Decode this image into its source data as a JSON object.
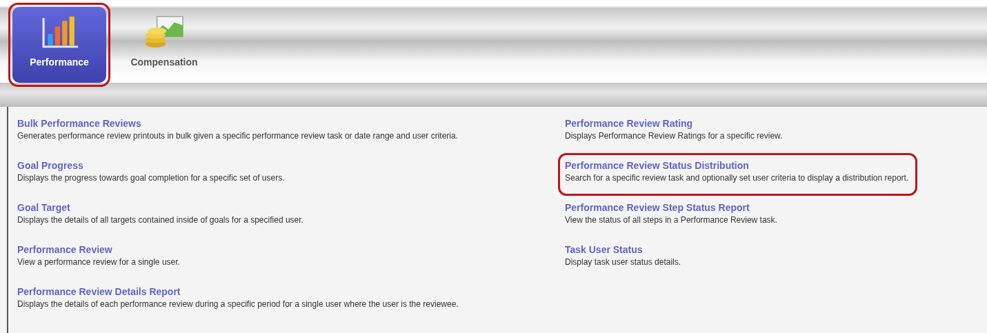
{
  "tabs": [
    {
      "label": "Performance",
      "kind": "bar-chart",
      "selected": true,
      "highlighted": true
    },
    {
      "label": "Compensation",
      "kind": "coins-chart",
      "selected": false,
      "highlighted": false
    }
  ],
  "reports": {
    "columns": [
      [
        {
          "title": "Bulk Performance Reviews",
          "description": "Generates performance review printouts in bulk given a specific performance review task or date range and user criteria.",
          "highlighted": false
        },
        {
          "title": "Goal Progress",
          "description": "Displays the progress towards goal completion for a specific set of users.",
          "highlighted": false
        },
        {
          "title": "Goal Target",
          "description": "Displays the details of all targets contained inside of goals for a specified user.",
          "highlighted": false
        },
        {
          "title": "Performance Review",
          "description": "View a performance review for a single user.",
          "highlighted": false
        },
        {
          "title": "Performance Review Details Report",
          "description": "Displays the details of each performance review during a specific period for a single user where the user is the reviewee.",
          "highlighted": false
        }
      ],
      [
        {
          "title": "Performance Review Rating",
          "description": "Displays Performance Review Ratings for a specific review.",
          "highlighted": false
        },
        {
          "title": "Performance Review Status Distribution",
          "description": "Search for a specific review task and optionally set user criteria to display a distribution report.",
          "highlighted": true
        },
        {
          "title": "Performance Review Step Status Report",
          "description": "View the status of all steps in a Performance Review task.",
          "highlighted": false
        },
        {
          "title": "Task User Status",
          "description": "Display task user status details.",
          "highlighted": false
        }
      ]
    ]
  }
}
